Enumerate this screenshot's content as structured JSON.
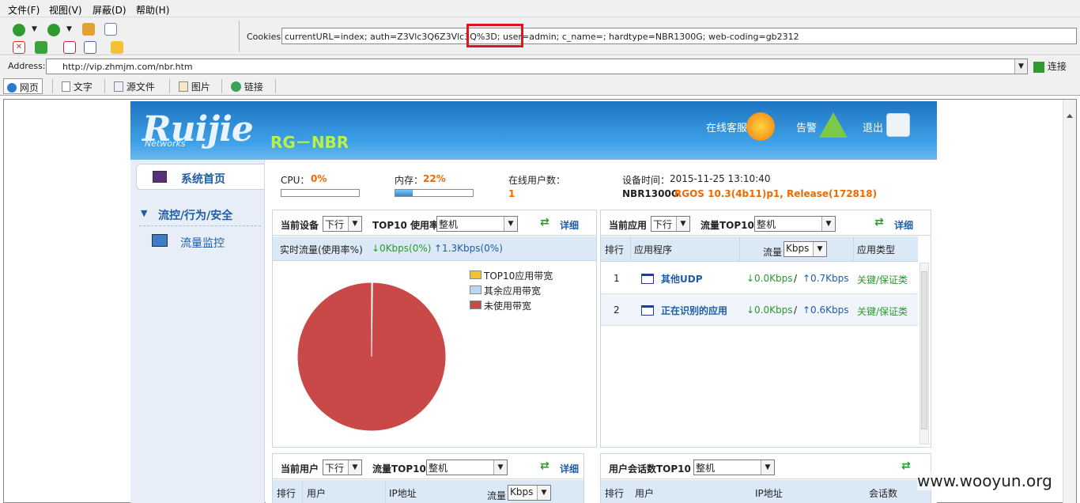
{
  "menu": [
    "文件(F)",
    "视图(V)",
    "屏蔽(D)",
    "帮助(H)"
  ],
  "cookies": {
    "label": "Cookies:",
    "value": "currentURL=index; auth=Z3Vlc3Q6Z3Vlc3Q%3D; user=admin; c_name=; hardtype=NBR1300G; web-coding=gb2312"
  },
  "address": {
    "label": "Address:",
    "value": "http://vip.zhmjm.com/nbr.htm",
    "go": "连接"
  },
  "tabs": [
    "网页",
    "文字",
    "源文件",
    "图片",
    "链接"
  ],
  "header": {
    "logo": "Ruijie",
    "logo_sub": "Networks",
    "product": "RG－NBR",
    "links": [
      "在线客服",
      "告警",
      "退出"
    ]
  },
  "sidebar": {
    "home": "系统首页",
    "group": "流控/行为/安全",
    "item": "流量监控"
  },
  "status": {
    "cpu_label": "CPU：",
    "cpu_value": "0%",
    "mem_label": "内存：",
    "mem_value": "22%",
    "users_label": "在线用户数：",
    "users_value": "1",
    "time_label": "设备时间：",
    "time_value": "2015-11-25 13:10:40",
    "model": "NBR1300G",
    "version": "RGOS 10.3(4b11)p1, Release(172818)",
    "cpu_fraction": 0,
    "mem_fraction": 0.22
  },
  "panel_device": {
    "label": "当前设备",
    "sel1": "下行",
    "top10": "TOP10 使用率",
    "sel2": "整机",
    "detail": "详细",
    "realtime_label": "实时流量(使用率%)",
    "down": "↓0Kbps(0%)",
    "up": "↑1.3Kbps(0%)",
    "legend": [
      "TOP10应用带宽",
      "其余应用带宽",
      "未使用带宽"
    ],
    "legend_colors": [
      "#f2c234",
      "#b9d9f5",
      "#c94848"
    ]
  },
  "chart_data": {
    "type": "pie",
    "labels": [
      "TOP10应用带宽",
      "其余应用带宽",
      "未使用带宽"
    ],
    "values": [
      0,
      0.2,
      99.8
    ],
    "colors": [
      "#f2c234",
      "#b9d9f5",
      "#c94848"
    ]
  },
  "panel_app": {
    "label": "当前应用",
    "sel1": "下行",
    "top10": "流量TOP10",
    "sel2": "整机",
    "detail": "详细",
    "headers": [
      "排行",
      "应用程序",
      "流量",
      "应用类型"
    ],
    "unit": "Kbps",
    "rows": [
      {
        "rank": "1",
        "name": "其他UDP",
        "down": "↓0.0Kbps",
        "sep": "/",
        "up": "↑0.7Kbps",
        "type": "关键/保证类"
      },
      {
        "rank": "2",
        "name": "正在识别的应用",
        "down": "↓0.0Kbps",
        "sep": "/",
        "up": "↑0.6Kbps",
        "type": "关键/保证类"
      }
    ]
  },
  "panel_user": {
    "label": "当前用户",
    "sel1": "下行",
    "top10": "流量TOP10",
    "sel2": "整机",
    "detail": "详细",
    "headers": [
      "排行",
      "用户",
      "IP地址",
      "流量"
    ],
    "unit": "Kbps"
  },
  "panel_session": {
    "label": "用户会话数TOP10",
    "sel2": "整机",
    "headers": [
      "排行",
      "用户",
      "IP地址",
      "会话数"
    ]
  },
  "watermark": "www.wooyun.org"
}
